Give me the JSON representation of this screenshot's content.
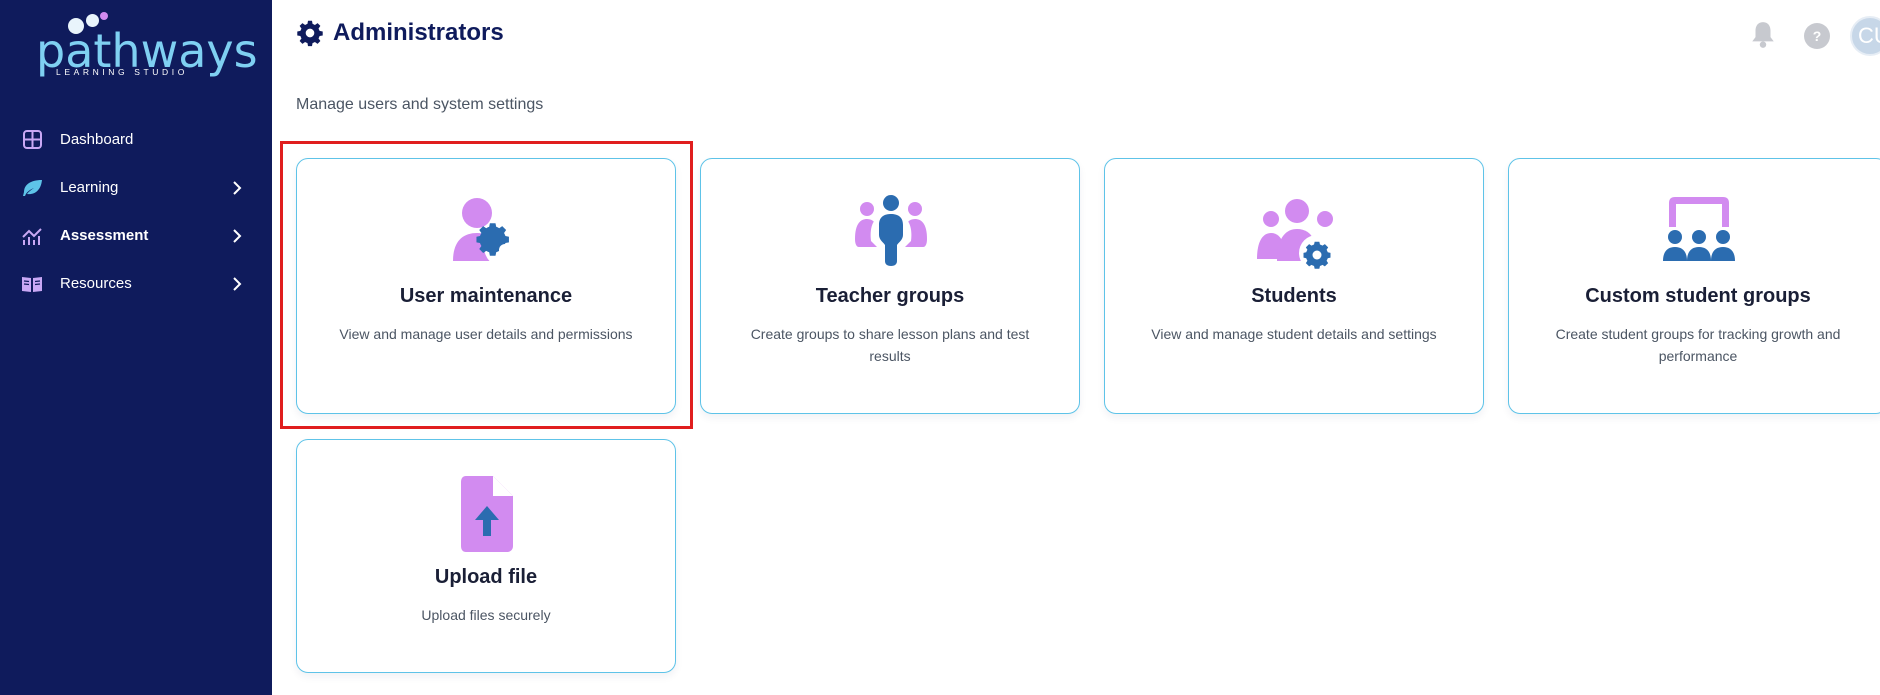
{
  "brand": {
    "logo_word": "pathways",
    "logo_sub": "LEARNING STUDIO"
  },
  "sidebar": {
    "items": [
      {
        "label": "Dashboard",
        "icon": "dashboard-grid-icon",
        "active": false,
        "has_submenu": false
      },
      {
        "label": "Learning",
        "icon": "leaf-icon",
        "active": false,
        "has_submenu": true
      },
      {
        "label": "Assessment",
        "icon": "chart-line-icon",
        "active": true,
        "has_submenu": true
      },
      {
        "label": "Resources",
        "icon": "book-open-icon",
        "active": false,
        "has_submenu": true
      }
    ]
  },
  "header": {
    "title": "Administrators",
    "title_icon": "gear-icon",
    "subtitle": "Manage users and system settings",
    "notifications_icon": "bell-icon",
    "help_label": "?",
    "avatar_initials": "CU"
  },
  "cards": [
    {
      "title": "User maintenance",
      "description": "View and manage user details and permissions",
      "icon": "user-gear-icon",
      "highlighted": true
    },
    {
      "title": "Teacher groups",
      "description": "Create groups to share lesson plans and test results",
      "icon": "teacher-group-icon",
      "highlighted": false
    },
    {
      "title": "Students",
      "description": "View and manage student details and settings",
      "icon": "students-gear-icon",
      "highlighted": false
    },
    {
      "title": "Custom student groups",
      "description": "Create student groups for tracking growth and performance",
      "icon": "custom-groups-icon",
      "highlighted": false
    },
    {
      "title": "Upload file",
      "description": "Upload files securely",
      "icon": "file-upload-icon",
      "highlighted": false
    }
  ],
  "colors": {
    "sidebar_bg": "#0f1b5c",
    "logo_blue": "#7fd0f2",
    "accent_purple": "#d28bf0",
    "accent_blue": "#2b6cb0",
    "card_border": "#5ec3e8",
    "highlight_red": "#e01e1e"
  }
}
